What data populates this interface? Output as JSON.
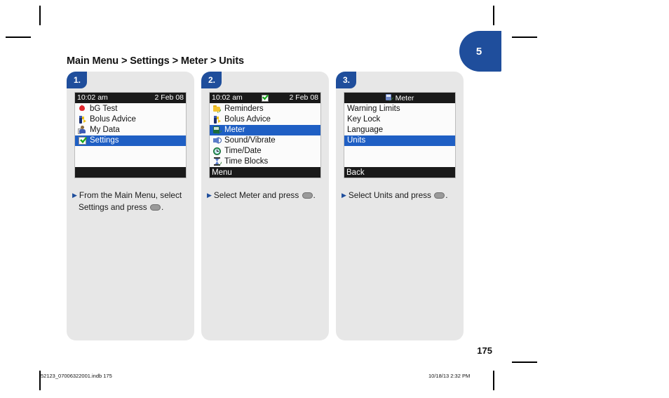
{
  "document": {
    "breadcrumb": "Main Menu > Settings > Meter > Units",
    "page_tab_number": "5",
    "folio": "175",
    "print_line_left": "52123_07006322001.indb   175",
    "print_line_right": "10/18/13   2:32 PM",
    "accent_color": "#1f4e9c",
    "selection_color": "#1f5fc4",
    "card_color": "#e7e7e7"
  },
  "steps": [
    {
      "badge": "1.",
      "screen": {
        "type": "statusbar",
        "statusbar": {
          "time": "10:02 am",
          "date": "2 Feb 08",
          "center_icon": ""
        },
        "rows": [
          {
            "icon": "blood-drop-icon",
            "label": "bG Test",
            "selected": false
          },
          {
            "icon": "bolus-advice-icon",
            "label": "Bolus Advice",
            "selected": false
          },
          {
            "icon": "my-data-icon",
            "label": "My Data",
            "selected": false
          },
          {
            "icon": "settings-check-icon",
            "label": "Settings",
            "selected": true
          }
        ],
        "blank_rows": 2,
        "softkey": ""
      },
      "caption_lines": [
        "From the Main Menu, select",
        "Settings and press "
      ],
      "caption_end": "."
    },
    {
      "badge": "2.",
      "screen": {
        "type": "statusbar",
        "statusbar": {
          "time": "10:02 am",
          "date": "2 Feb 08",
          "center_icon": "green-check-icon"
        },
        "rows": [
          {
            "icon": "reminders-icon",
            "label": "Reminders",
            "selected": false
          },
          {
            "icon": "bolus-advice-icon",
            "label": "Bolus Advice",
            "selected": false
          },
          {
            "icon": "meter-icon",
            "label": "Meter",
            "selected": true
          },
          {
            "icon": "sound-vibrate-icon",
            "label": "Sound/Vibrate",
            "selected": false
          },
          {
            "icon": "time-date-icon",
            "label": "Time/Date",
            "selected": false
          },
          {
            "icon": "time-blocks-icon",
            "label": "Time Blocks",
            "selected": false
          }
        ],
        "blank_rows": 0,
        "softkey": "Menu"
      },
      "caption_lines": [
        "Select Meter and press "
      ],
      "caption_end": "."
    },
    {
      "badge": "3.",
      "screen": {
        "type": "titlebar",
        "titlebar": {
          "icon": "meter-icon",
          "title": "Meter"
        },
        "rows": [
          {
            "icon": "",
            "label": "Warning Limits",
            "selected": false
          },
          {
            "icon": "",
            "label": "Key Lock",
            "selected": false
          },
          {
            "icon": "",
            "label": "Language",
            "selected": false
          },
          {
            "icon": "",
            "label": "Units",
            "selected": true
          }
        ],
        "blank_rows": 2,
        "softkey": "Back"
      },
      "caption_lines": [
        "Select Units and press "
      ],
      "caption_end": "."
    }
  ]
}
